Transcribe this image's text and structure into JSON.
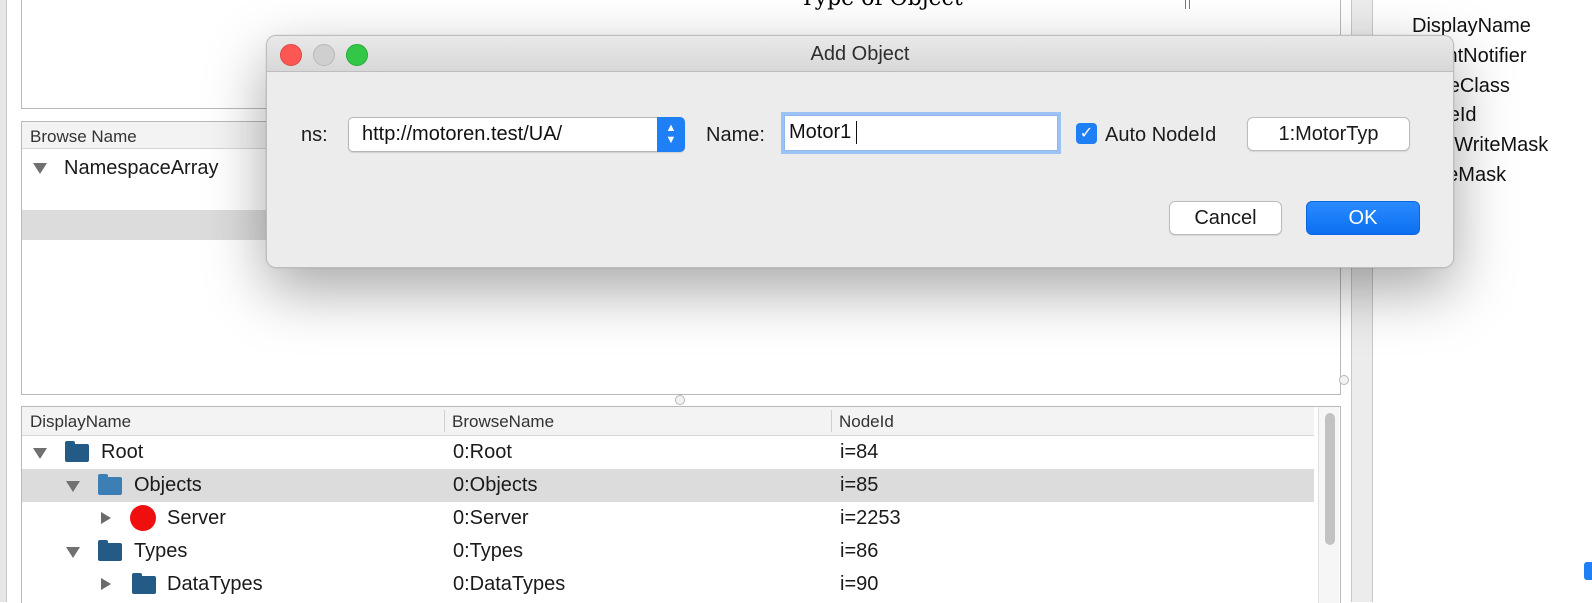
{
  "background": {
    "top_text": "Type of Object",
    "upper_panel": {
      "column_header": "Browse Name",
      "row": "NamespaceArray"
    },
    "right_list": [
      "DisplayName",
      "EventNotifier",
      "NodeClass",
      "NodeId",
      "UserWriteMask",
      "WriteMask"
    ]
  },
  "dialog": {
    "title": "Add Object",
    "ns_label": "ns:",
    "ns_value": "http://motoren.test/UA/",
    "name_label": "Name:",
    "name_value": "Motor1",
    "auto_nodeid_label": "Auto NodeId",
    "auto_nodeid_checked": true,
    "type_button": "1:MotorTyp",
    "cancel": "Cancel",
    "ok": "OK"
  },
  "tree": {
    "columns": [
      "DisplayName",
      "BrowseName",
      "NodeId"
    ],
    "rows": [
      {
        "display": "Root",
        "browse": "0:Root",
        "nodeid": "i=84",
        "expanded": true,
        "icon": "folder-dark-icon"
      },
      {
        "display": "Objects",
        "browse": "0:Objects",
        "nodeid": "i=85",
        "expanded": true,
        "selected": true,
        "icon": "folder-light-icon"
      },
      {
        "display": "Server",
        "browse": "0:Server",
        "nodeid": "i=2253",
        "expanded": false,
        "icon": "red-circle-icon"
      },
      {
        "display": "Types",
        "browse": "0:Types",
        "nodeid": "i=86",
        "expanded": true,
        "icon": "folder-dark-icon"
      },
      {
        "display": "DataTypes",
        "browse": "0:DataTypes",
        "nodeid": "i=90",
        "expanded": false,
        "icon": "folder-dark-icon"
      }
    ]
  },
  "colors": {
    "accent": "#1f7ff5",
    "close": "#fc5753",
    "maximize": "#33c748",
    "server_icon": "#ef0f0f",
    "selection": "#dcdcdc"
  }
}
